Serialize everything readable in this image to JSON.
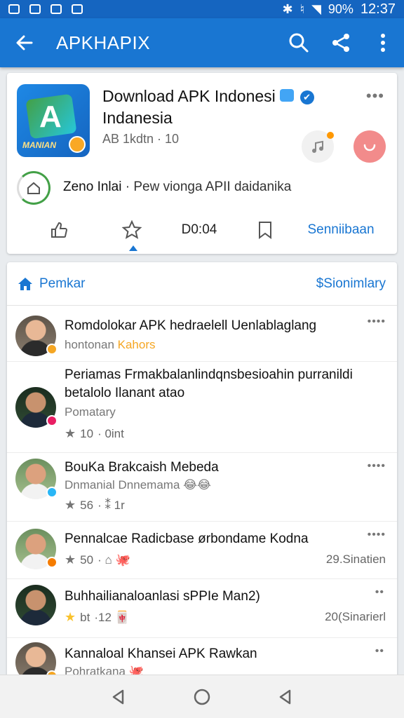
{
  "status_bar": {
    "battery": "90%",
    "time": "12:37"
  },
  "app_bar": {
    "title": "APKHAPIX",
    "icons": [
      "back-arrow-icon",
      "search-icon",
      "share-icon",
      "more-vert-icon"
    ]
  },
  "app_card": {
    "title_line1": "Download APK Indonesi",
    "title_line2": "Indanesia",
    "meta": "AB 1kdtn · 10",
    "icon_brand_text": "MANIAN",
    "icon_letter": "A",
    "more": "•••",
    "promo_label": "Zeno Inlai",
    "promo_text": " · Pew vionga APII daidanika",
    "actions": {
      "count": "D0:04",
      "subscribe": "Senniibaan"
    }
  },
  "section": {
    "left_label": "Pemkar",
    "right_label": "$Sionimlary"
  },
  "items": [
    {
      "title": "Romdolokar APK hedraelell Uenlablaglang",
      "sub_prefix": "hontonan ",
      "sub_highlight": "Kahors",
      "more": "••••"
    },
    {
      "title": "Periamas Frmakbalanlindqnsbesioahin purranildi betalolo Ilanant atao",
      "sub": "Pomatary",
      "rating": "10",
      "meta": "· 0int"
    },
    {
      "title": "BouKa Brakcaish Mebeda",
      "sub": "Dnmanial Dnnemama",
      "emoji": "😂😂",
      "rating": "56",
      "meta": "· ⁑ 1r",
      "more": "••••"
    },
    {
      "title": "Pennalcae Radicbase ørbondame Kodna",
      "rating": "50",
      "meta": "· ⌂ 🐙",
      "time": "29.Sinatien",
      "more": "••••"
    },
    {
      "title": "Buhhailianaloanlasi sPPIe Man2)",
      "rating": "bt",
      "meta": "·12 🀄",
      "time": "20(Sinarierl",
      "more": "••"
    },
    {
      "title": "Kannaloal Khansei APK Rawkan",
      "sub": "Pohratkana",
      "emoji": "🐙",
      "more": "••"
    }
  ],
  "colors": {
    "primary": "#1976d2",
    "status_bar": "#1565c0",
    "accent_gold": "#f5a623"
  }
}
